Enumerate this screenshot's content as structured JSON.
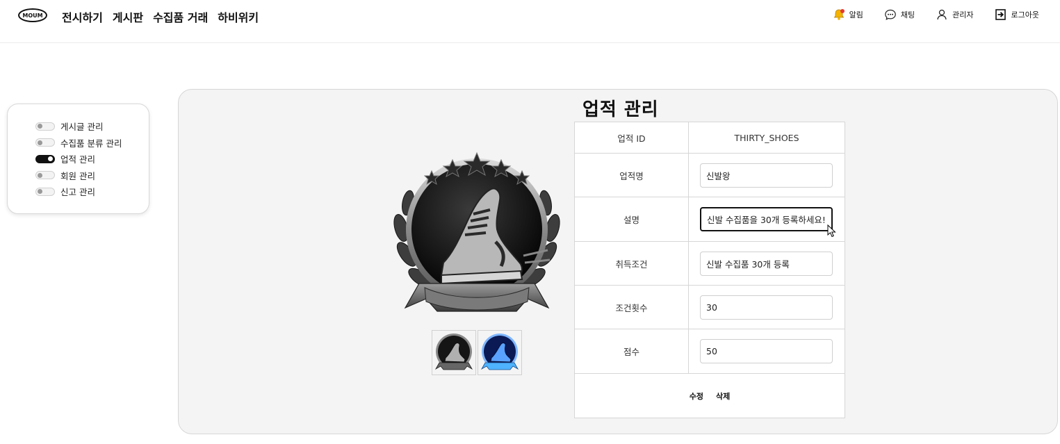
{
  "header": {
    "logo": "MOUM",
    "nav": [
      "전시하기",
      "게시판",
      "수집품 거래",
      "하비위키"
    ],
    "right": [
      {
        "label": "알림",
        "icon": "bell-icon"
      },
      {
        "label": "채팅",
        "icon": "chat-icon"
      },
      {
        "label": "관리자",
        "icon": "user-icon"
      },
      {
        "label": "로그아웃",
        "icon": "logout-icon"
      }
    ]
  },
  "sidebar": {
    "items": [
      {
        "label": "게시글 관리",
        "active": false
      },
      {
        "label": "수집품 분류 관리",
        "active": false
      },
      {
        "label": "업적 관리",
        "active": true
      },
      {
        "label": "회원 관리",
        "active": false
      },
      {
        "label": "신고 관리",
        "active": false
      }
    ]
  },
  "main": {
    "title": "업적 관리",
    "badge_icon": "shoe-badge-icon",
    "thumbnails": [
      "shoe-badge-dark-icon",
      "shoe-badge-blue-icon"
    ],
    "table": {
      "id_label": "업적 ID",
      "id_value": "THIRTY_SHOES",
      "name_label": "업적명",
      "name_value": "신발왕",
      "desc_label": "설명",
      "desc_value": "신발 수집품을 30개 등록하세요!",
      "cond_label": "취득조건",
      "cond_value": "신발 수집품 30개 등록",
      "count_label": "조건횟수",
      "count_value": "30",
      "score_label": "점수",
      "score_value": "50"
    },
    "actions": {
      "edit": "수정",
      "delete": "삭제"
    }
  },
  "colors": {
    "panel_bg": "#f4f4f4",
    "toggle_on": "#111111",
    "bell": "#f5b400"
  }
}
